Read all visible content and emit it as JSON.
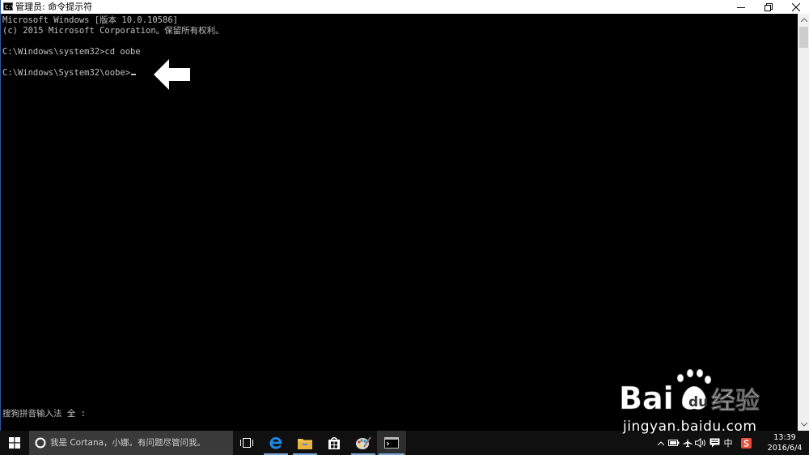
{
  "window": {
    "title": "管理员: 命令提示符",
    "icon_text": "C:\\"
  },
  "console": {
    "lines": [
      "Microsoft Windows [版本 10.0.10586]",
      "(c) 2015 Microsoft Corporation。保留所有权利。",
      "",
      "C:\\Windows\\system32>cd oobe",
      "",
      "C:\\Windows\\System32\\oobe>"
    ],
    "ime_status": "搜狗拼音输入法 全 :"
  },
  "taskbar": {
    "search_placeholder": "我是 Cortana，小娜。有问题尽管问我。",
    "apps": [
      "task-view",
      "edge",
      "file-explorer",
      "store",
      "paint",
      "command-prompt"
    ],
    "tray": {
      "ime_label": "中",
      "time": "13:39",
      "date": "2016/6/4"
    }
  },
  "watermark": {
    "brand": "Baidu 经验",
    "url": "jingyan.baidu.com"
  },
  "colors": {
    "console_bg": "#000000",
    "console_text": "#c0c0c0",
    "taskbar_bg": "#101010",
    "accent": "#0078d7"
  }
}
